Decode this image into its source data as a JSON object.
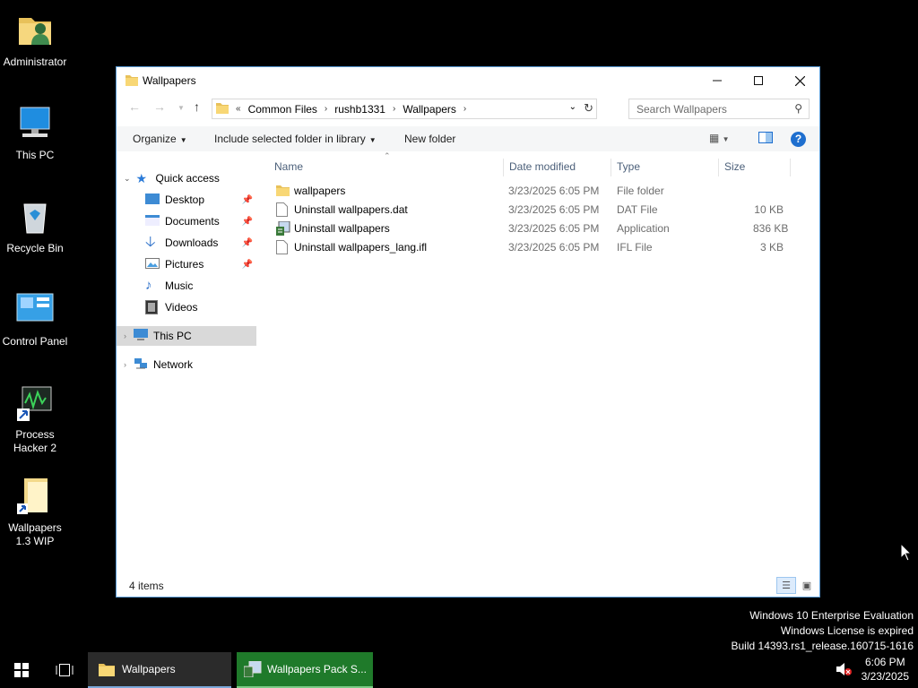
{
  "desktop": {
    "icons": [
      {
        "label": "Administrator",
        "icon": "user-folder-icon"
      },
      {
        "label": "This PC",
        "icon": "computer-icon"
      },
      {
        "label": "Recycle Bin",
        "icon": "recycle-bin-icon"
      },
      {
        "label": "Control Panel",
        "icon": "control-panel-icon"
      },
      {
        "label": "Process Hacker 2",
        "icon": "process-hacker-icon"
      },
      {
        "label": "Wallpapers 1.3 WIP",
        "icon": "folder-shortcut-icon"
      }
    ]
  },
  "window": {
    "title": "Wallpapers",
    "breadcrumb": [
      "Common Files",
      "rushb1331",
      "Wallpapers"
    ],
    "search_placeholder": "Search Wallpapers",
    "toolbar": {
      "organize": "Organize",
      "include": "Include selected folder in library",
      "new_folder": "New folder"
    },
    "nav": {
      "quick_access": "Quick access",
      "items": [
        {
          "label": "Desktop",
          "icon": "desktop-icon",
          "pinned": true
        },
        {
          "label": "Documents",
          "icon": "documents-icon",
          "pinned": true
        },
        {
          "label": "Downloads",
          "icon": "downloads-icon",
          "pinned": true
        },
        {
          "label": "Pictures",
          "icon": "pictures-icon",
          "pinned": true
        },
        {
          "label": "Music",
          "icon": "music-icon",
          "pinned": false
        },
        {
          "label": "Videos",
          "icon": "videos-icon",
          "pinned": false
        }
      ],
      "this_pc": "This PC",
      "network": "Network"
    },
    "columns": {
      "name": "Name",
      "date": "Date modified",
      "type": "Type",
      "size": "Size"
    },
    "files": [
      {
        "name": "wallpapers",
        "date": "3/23/2025 6:05 PM",
        "type": "File folder",
        "size": "",
        "icon": "folder-icon"
      },
      {
        "name": "Uninstall wallpapers.dat",
        "date": "3/23/2025 6:05 PM",
        "type": "DAT File",
        "size": "10 KB",
        "icon": "file-icon"
      },
      {
        "name": "Uninstall wallpapers",
        "date": "3/23/2025 6:05 PM",
        "type": "Application",
        "size": "836 KB",
        "icon": "installer-icon"
      },
      {
        "name": "Uninstall wallpapers_lang.ifl",
        "date": "3/23/2025 6:05 PM",
        "type": "IFL File",
        "size": "3 KB",
        "icon": "file-icon"
      }
    ],
    "status": "4 items"
  },
  "watermark": {
    "line1": "Windows 10 Enterprise Evaluation",
    "line2": "Windows License is expired",
    "line3": "Build 14393.rs1_release.160715-1616"
  },
  "taskbar": {
    "tasks": [
      {
        "label": "Wallpapers"
      },
      {
        "label": "Wallpapers Pack S..."
      }
    ],
    "time": "6:06 PM",
    "date": "3/23/2025"
  },
  "colors": {
    "accent": "#1f6fcf",
    "selection": "#d9d9d9",
    "active_task": "#1f7a2a"
  }
}
